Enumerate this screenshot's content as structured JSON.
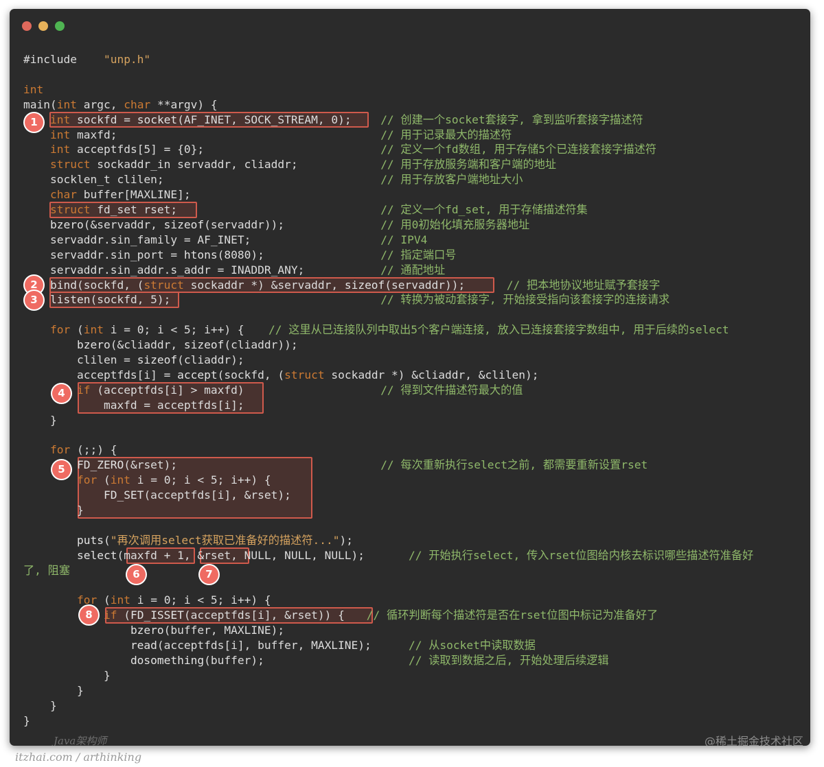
{
  "window": {
    "buttons": [
      "close",
      "minimize",
      "zoom"
    ]
  },
  "colors": {
    "background": "#2b2b2b",
    "code_text": "#dcdcdc",
    "comment": "#8fb86a",
    "keyword": "#cc7a33",
    "highlight_box": "#d05a4c",
    "badge": "#ef6b62",
    "close_dot": "#e0695c",
    "minimize_dot": "#e6b15a",
    "zoom_dot": "#4fb452"
  },
  "code": {
    "lines": [
      "#include    \"unp.h\"",
      "",
      "int",
      "main(int argc, char **argv) {",
      "    int sockfd = socket(AF_INET, SOCK_STREAM, 0);",
      "    int maxfd;",
      "    int acceptfds[5] = {0};",
      "    struct sockaddr_in servaddr, cliaddr;",
      "    socklen_t clilen;",
      "    char buffer[MAXLINE];",
      "    struct fd_set rset;",
      "    bzero(&servaddr, sizeof(servaddr));",
      "    servaddr.sin_family = AF_INET;",
      "    servaddr.sin_port = htons(8080);",
      "    servaddr.sin_addr.s_addr = INADDR_ANY;",
      "    bind(sockfd, (struct sockaddr *) &servaddr, sizeof(servaddr));",
      "    listen(sockfd, 5);",
      "",
      "    for (int i = 0; i < 5; i++) {",
      "        bzero(&cliaddr, sizeof(cliaddr));",
      "        clilen = sizeof(cliaddr);",
      "        acceptfds[i] = accept(sockfd, (struct sockaddr *) &cliaddr, &clilen);",
      "        if (acceptfds[i] > maxfd)",
      "            maxfd = acceptfds[i];",
      "    }",
      "",
      "    for (;;) {",
      "        FD_ZERO(&rset);",
      "        for (int i = 0; i < 5; i++) {",
      "            FD_SET(acceptfds[i], &rset);",
      "        }",
      "",
      "        puts(\"再次调用select获取已准备好的描述符...\");",
      "        select(maxfd + 1, &rset, NULL, NULL, NULL);",
      "了, 阻塞",
      "",
      "        for (int i = 0; i < 5; i++) {",
      "            if (FD_ISSET(acceptfds[i], &rset)) {",
      "                bzero(buffer, MAXLINE);",
      "                read(acceptfds[i], buffer, MAXLINE);",
      "                dosomething(buffer);",
      "            }",
      "        }",
      "    }",
      "}"
    ],
    "comments": [
      {
        "line": 4,
        "text": "// 创建一个socket套接字, 拿到监听套接字描述符"
      },
      {
        "line": 5,
        "text": "// 用于记录最大的描述符"
      },
      {
        "line": 6,
        "text": "// 定义一个fd数组, 用于存储5个已连接套接字描述符"
      },
      {
        "line": 7,
        "text": "// 用于存放服务端和客户端的地址"
      },
      {
        "line": 8,
        "text": "// 用于存放客户端地址大小"
      },
      {
        "line": 10,
        "text": "// 定义一个fd_set, 用于存储描述符集"
      },
      {
        "line": 11,
        "text": "// 用0初始化填充服务器地址"
      },
      {
        "line": 12,
        "text": "// IPV4"
      },
      {
        "line": 13,
        "text": "// 指定端口号"
      },
      {
        "line": 14,
        "text": "// 通配地址"
      },
      {
        "line": 15,
        "text": "// 把本地协议地址赋予套接字"
      },
      {
        "line": 16,
        "text": "// 转换为被动套接字, 开始接受指向该套接字的连接请求"
      },
      {
        "line": 18,
        "text": "// 这里从已连接队列中取出5个客户端连接, 放入已连接套接字数组中, 用于后续的select"
      },
      {
        "line": 22,
        "text": "// 得到文件描述符最大的值"
      },
      {
        "line": 27,
        "text": "// 每次重新执行select之前, 都需要重新设置rset"
      },
      {
        "line": 33,
        "text": "// 开始执行select, 传入rset位图给内核去标识哪些描述符准备好"
      },
      {
        "line": 37,
        "text": "// 循环判断每个描述符是否在rset位图中标记为准备好了"
      },
      {
        "line": 39,
        "text": "// 从socket中读取数据"
      },
      {
        "line": 40,
        "text": "// 读取到数据之后, 开始处理后续逻辑"
      }
    ]
  },
  "markers": [
    "1",
    "2",
    "3",
    "4",
    "5",
    "6",
    "7",
    "8"
  ],
  "watermarks": {
    "left": "Java架构师",
    "right": "@稀土掘金技术社区",
    "bottom": "itzhai.com / arthinking"
  }
}
